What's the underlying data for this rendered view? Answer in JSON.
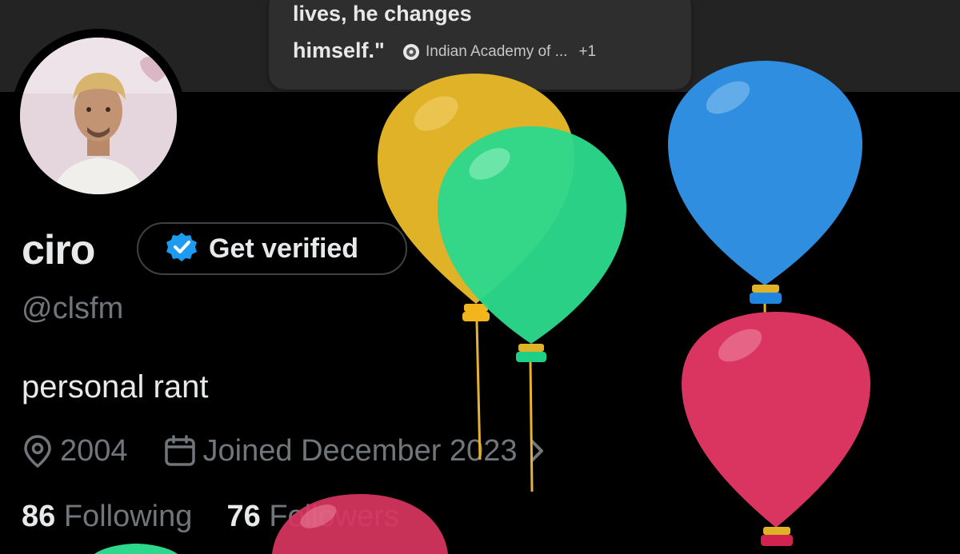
{
  "quote_card": {
    "line1": "lives, he changes",
    "line2": "himself.\"",
    "source_label": "Indian Academy of ...",
    "source_more": "+1"
  },
  "profile": {
    "name": "ciro",
    "verify_button": "Get verified",
    "handle": "@clsfm",
    "bio": "personal rant",
    "location": "2004",
    "joined": "Joined December 2023",
    "following_count": "86",
    "following_label": "Following",
    "followers_count": "76",
    "followers_label": "Followers"
  },
  "icons": {
    "verified": "verified-badge-icon",
    "location": "location-pin-icon",
    "calendar": "calendar-icon",
    "chevron": "chevron-right-icon"
  },
  "colors": {
    "accent": "#1d9bf0",
    "balloon_yellow": "#e0b227",
    "balloon_green": "#2dd88c",
    "balloon_blue": "#2f8ee0",
    "balloon_red": "#e03a62"
  }
}
